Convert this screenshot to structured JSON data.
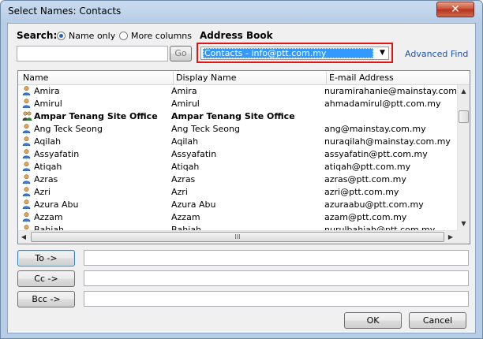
{
  "window": {
    "title": "Select Names: Contacts",
    "close_glyph": "✕"
  },
  "search": {
    "label": "Search:",
    "name_only_label": "Name only",
    "more_columns_label": "More columns",
    "selected": "name_only",
    "query_value": "",
    "go_label": "Go"
  },
  "address_book": {
    "label": "Address Book",
    "selected": "Contacts - info@ptt.com.my",
    "advanced_find_label": "Advanced Find"
  },
  "list": {
    "columns": [
      "Name",
      "Display Name",
      "E-mail Address"
    ],
    "rows": [
      {
        "name": "Amira",
        "display": "Amira",
        "email": "nuramirahanie@mainstay.com.my",
        "type": "person"
      },
      {
        "name": "Amirul",
        "display": "Amirul",
        "email": "ahmadamirul@ptt.com.my",
        "type": "person"
      },
      {
        "name": "Ampar Tenang Site Office",
        "display": "Ampar Tenang Site Office",
        "email": "",
        "type": "group"
      },
      {
        "name": "Ang Teck Seong",
        "display": "Ang Teck Seong",
        "email": "ang@mainstay.com.my",
        "type": "person"
      },
      {
        "name": "Aqilah",
        "display": "Aqilah",
        "email": "nuraqilah@mainstay.com.my",
        "type": "person"
      },
      {
        "name": "Assyafatin",
        "display": "Assyafatin",
        "email": "assyafatin@ptt.com.my",
        "type": "person"
      },
      {
        "name": "Atiqah",
        "display": "Atiqah",
        "email": "atiqah@ptt.com.my",
        "type": "person"
      },
      {
        "name": "Azras",
        "display": "Azras",
        "email": "azras@ptt.com.my",
        "type": "person"
      },
      {
        "name": "Azri",
        "display": "Azri",
        "email": "azri@ptt.com.my",
        "type": "person"
      },
      {
        "name": "Azura Abu",
        "display": "Azura Abu",
        "email": "azuraabu@ptt.com.my",
        "type": "person"
      },
      {
        "name": "Azzam",
        "display": "Azzam",
        "email": "azam@ptt.com.my",
        "type": "person"
      },
      {
        "name": "Bahiah",
        "display": "Bahiah",
        "email": "nurulbahiah@ptt.com.my",
        "type": "person"
      }
    ],
    "hscroll_grip": "III"
  },
  "recipients": {
    "to_label": "To ->",
    "cc_label": "Cc ->",
    "bcc_label": "Bcc ->",
    "to_value": "",
    "cc_value": "",
    "bcc_value": ""
  },
  "footer": {
    "ok_label": "OK",
    "cancel_label": "Cancel"
  },
  "colors": {
    "highlight": "#3399ff",
    "outline": "#e21515",
    "link": "#1c54ad"
  }
}
